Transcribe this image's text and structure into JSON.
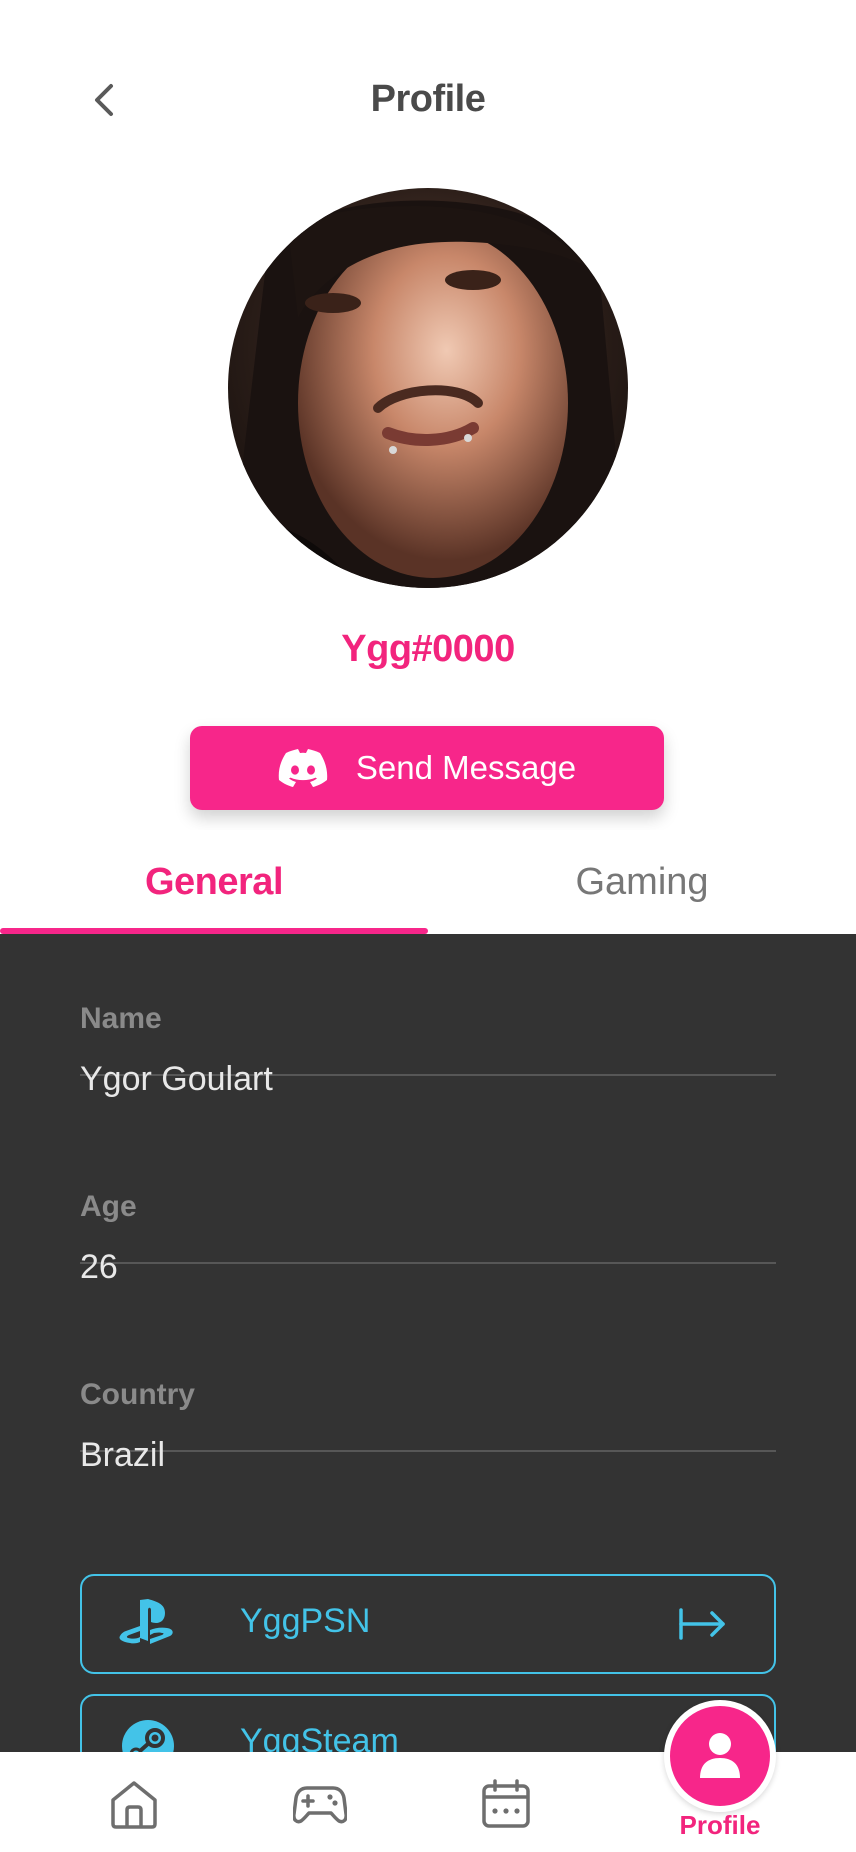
{
  "header": {
    "title": "Profile",
    "back_icon": "chevron-left-icon"
  },
  "profile": {
    "handle": "Ygg#0000",
    "avatar": "profile-photo"
  },
  "send_button": {
    "label": "Send Message",
    "icon": "discord-icon"
  },
  "tabs": [
    {
      "label": "General",
      "active": true
    },
    {
      "label": "Gaming",
      "active": false
    }
  ],
  "fields": [
    {
      "label": "Name",
      "value": "Ygor Goulart"
    },
    {
      "label": "Age",
      "value": "26"
    },
    {
      "label": "Country",
      "value": "Brazil"
    }
  ],
  "accounts": [
    {
      "label": "YggPSN",
      "icon": "playstation-icon",
      "action_icon": "arrow-right-to-bar-icon"
    },
    {
      "label": "YggSteam",
      "icon": "steam-icon"
    }
  ],
  "bottom_nav": {
    "items": [
      {
        "icon": "home-icon"
      },
      {
        "icon": "gamepad-icon"
      },
      {
        "icon": "calendar-icon"
      }
    ],
    "active": {
      "label": "Profile",
      "icon": "user-icon"
    }
  },
  "colors": {
    "accent": "#f7268a",
    "accent_text": "#f2247d",
    "panel_bg": "#333333",
    "account_border": "#43c3e8"
  }
}
